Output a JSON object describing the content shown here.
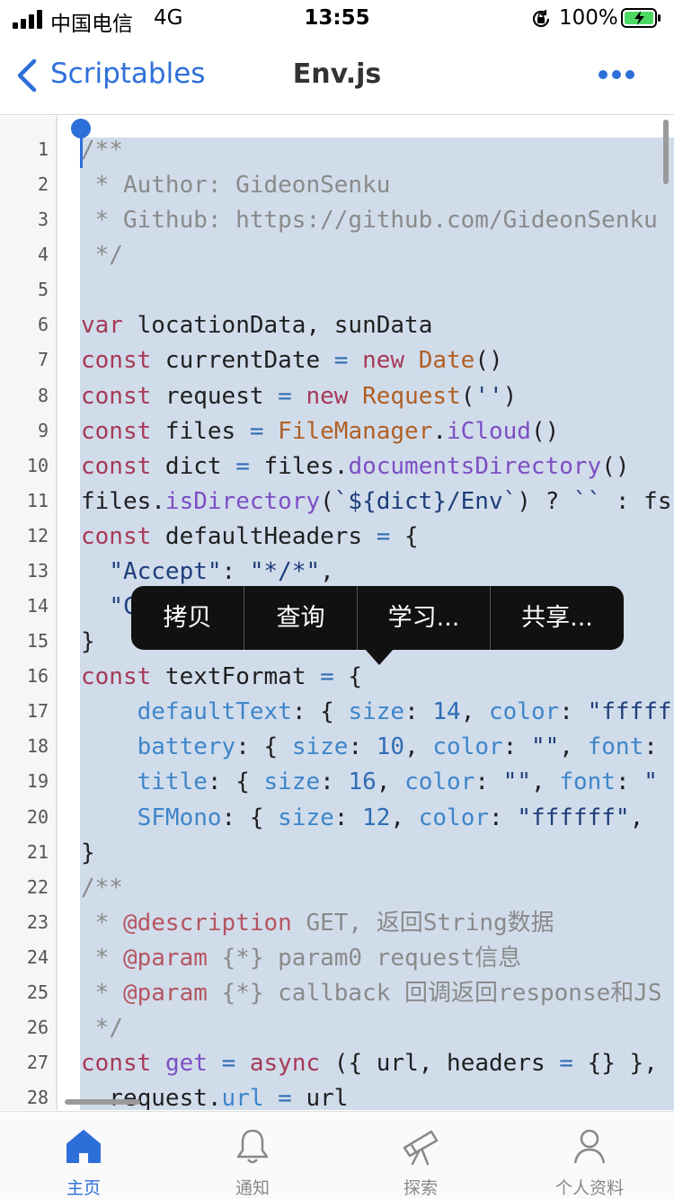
{
  "status_bar": {
    "carrier": "中国电信",
    "network": "4G",
    "time": "13:55",
    "battery_percent": "100%"
  },
  "nav": {
    "back_label": "Scriptables",
    "title": "Env.js",
    "more_icon": "ellipsis-icon",
    "accent_color": "#2d6fd9"
  },
  "editor": {
    "line_numbers": [
      "1",
      "2",
      "3",
      "4",
      "5",
      "6",
      "7",
      "8",
      "9",
      "10",
      "11",
      "12",
      "13",
      "14",
      "15",
      "16",
      "17",
      "18",
      "19",
      "20",
      "21",
      "22",
      "23",
      "24",
      "25",
      "26",
      "27",
      "28"
    ],
    "lines": [
      [
        [
          "c-com",
          "/**"
        ]
      ],
      [
        [
          "c-com",
          " * Author: GideonSenku"
        ]
      ],
      [
        [
          "c-com",
          " * Github: https://github.com/GideonSenku"
        ]
      ],
      [
        [
          "c-com",
          " */"
        ]
      ],
      [],
      [
        [
          "c-kw",
          "var"
        ],
        [
          "c-plain",
          " locationData, sunData"
        ]
      ],
      [
        [
          "c-kw",
          "const"
        ],
        [
          "c-plain",
          " currentDate "
        ],
        [
          "c-op",
          "="
        ],
        [
          "c-plain",
          " "
        ],
        [
          "c-kw",
          "new"
        ],
        [
          "c-plain",
          " "
        ],
        [
          "c-cls",
          "Date"
        ],
        [
          "c-plain",
          "()"
        ]
      ],
      [
        [
          "c-kw",
          "const"
        ],
        [
          "c-plain",
          " request "
        ],
        [
          "c-op",
          "="
        ],
        [
          "c-plain",
          " "
        ],
        [
          "c-kw",
          "new"
        ],
        [
          "c-plain",
          " "
        ],
        [
          "c-cls",
          "Request"
        ],
        [
          "c-plain",
          "("
        ],
        [
          "c-str",
          "''"
        ],
        [
          "c-plain",
          ")"
        ]
      ],
      [
        [
          "c-kw",
          "const"
        ],
        [
          "c-plain",
          " files "
        ],
        [
          "c-op",
          "="
        ],
        [
          "c-plain",
          " "
        ],
        [
          "c-cls",
          "FileManager"
        ],
        [
          "c-plain",
          "."
        ],
        [
          "c-fn",
          "iCloud"
        ],
        [
          "c-plain",
          "()"
        ]
      ],
      [
        [
          "c-kw",
          "const"
        ],
        [
          "c-plain",
          " dict "
        ],
        [
          "c-op",
          "="
        ],
        [
          "c-plain",
          " files."
        ],
        [
          "c-fn",
          "documentsDirectory"
        ],
        [
          "c-plain",
          "()"
        ]
      ],
      [
        [
          "c-plain",
          "files."
        ],
        [
          "c-fn",
          "isDirectory"
        ],
        [
          "c-plain",
          "("
        ],
        [
          "c-str",
          "`${dict}/Env`"
        ],
        [
          "c-plain",
          ") ? "
        ],
        [
          "c-str",
          "``"
        ],
        [
          "c-plain",
          " : fs"
        ]
      ],
      [
        [
          "c-kw",
          "const"
        ],
        [
          "c-plain",
          " defaultHeaders "
        ],
        [
          "c-op",
          "="
        ],
        [
          "c-plain",
          " {"
        ]
      ],
      [
        [
          "c-plain",
          "  "
        ],
        [
          "c-str",
          "\"Accept\""
        ],
        [
          "c-plain",
          ": "
        ],
        [
          "c-str",
          "\"*/*\""
        ],
        [
          "c-plain",
          ","
        ]
      ],
      [
        [
          "c-plain",
          "  "
        ],
        [
          "c-str",
          "\"C"
        ]
      ],
      [
        [
          "c-plain",
          "}"
        ]
      ],
      [
        [
          "c-kw",
          "const"
        ],
        [
          "c-plain",
          " textFormat "
        ],
        [
          "c-op",
          "="
        ],
        [
          "c-plain",
          " {"
        ]
      ],
      [
        [
          "c-plain",
          "    "
        ],
        [
          "c-prop",
          "defaultText"
        ],
        [
          "c-plain",
          ": { "
        ],
        [
          "c-prop",
          "size"
        ],
        [
          "c-plain",
          ": "
        ],
        [
          "c-num",
          "14"
        ],
        [
          "c-plain",
          ", "
        ],
        [
          "c-prop",
          "color"
        ],
        [
          "c-plain",
          ": "
        ],
        [
          "c-str",
          "\"fffff"
        ]
      ],
      [
        [
          "c-plain",
          "    "
        ],
        [
          "c-prop",
          "battery"
        ],
        [
          "c-plain",
          ": { "
        ],
        [
          "c-prop",
          "size"
        ],
        [
          "c-plain",
          ": "
        ],
        [
          "c-num",
          "10"
        ],
        [
          "c-plain",
          ", "
        ],
        [
          "c-prop",
          "color"
        ],
        [
          "c-plain",
          ": "
        ],
        [
          "c-str",
          "\"\""
        ],
        [
          "c-plain",
          ", "
        ],
        [
          "c-prop",
          "font"
        ],
        [
          "c-plain",
          ":"
        ]
      ],
      [
        [
          "c-plain",
          "    "
        ],
        [
          "c-prop",
          "title"
        ],
        [
          "c-plain",
          ": { "
        ],
        [
          "c-prop",
          "size"
        ],
        [
          "c-plain",
          ": "
        ],
        [
          "c-num",
          "16"
        ],
        [
          "c-plain",
          ", "
        ],
        [
          "c-prop",
          "color"
        ],
        [
          "c-plain",
          ": "
        ],
        [
          "c-str",
          "\"\""
        ],
        [
          "c-plain",
          ", "
        ],
        [
          "c-prop",
          "font"
        ],
        [
          "c-plain",
          ": "
        ],
        [
          "c-str",
          "\""
        ]
      ],
      [
        [
          "c-plain",
          "    "
        ],
        [
          "c-prop",
          "SFMono"
        ],
        [
          "c-plain",
          ": { "
        ],
        [
          "c-prop",
          "size"
        ],
        [
          "c-plain",
          ": "
        ],
        [
          "c-num",
          "12"
        ],
        [
          "c-plain",
          ", "
        ],
        [
          "c-prop",
          "color"
        ],
        [
          "c-plain",
          ": "
        ],
        [
          "c-str",
          "\"ffffff\""
        ],
        [
          "c-plain",
          ", "
        ]
      ],
      [
        [
          "c-plain",
          "}"
        ]
      ],
      [
        [
          "c-com",
          "/**"
        ]
      ],
      [
        [
          "c-com",
          " * "
        ],
        [
          "c-tag",
          "@description"
        ],
        [
          "c-com",
          " GET, 返回String数据"
        ]
      ],
      [
        [
          "c-com",
          " * "
        ],
        [
          "c-tag",
          "@param"
        ],
        [
          "c-com",
          " {*} param0 request信息"
        ]
      ],
      [
        [
          "c-com",
          " * "
        ],
        [
          "c-tag",
          "@param"
        ],
        [
          "c-com",
          " {*} callback 回调返回response和JS"
        ]
      ],
      [
        [
          "c-com",
          " */"
        ]
      ],
      [
        [
          "c-kw",
          "const"
        ],
        [
          "c-plain",
          " "
        ],
        [
          "c-fn",
          "get"
        ],
        [
          "c-plain",
          " "
        ],
        [
          "c-op",
          "="
        ],
        [
          "c-plain",
          " "
        ],
        [
          "c-kw",
          "async"
        ],
        [
          "c-plain",
          " ({ url, headers "
        ],
        [
          "c-op",
          "="
        ],
        [
          "c-plain",
          " {} },"
        ]
      ],
      [
        [
          "c-plain",
          "  request."
        ],
        [
          "c-prop",
          "url"
        ],
        [
          "c-plain",
          " "
        ],
        [
          "c-op",
          "="
        ],
        [
          "c-plain",
          " url"
        ]
      ]
    ]
  },
  "context_menu": {
    "items": [
      "拷贝",
      "查询",
      "学习...",
      "共享..."
    ]
  },
  "tab_bar": {
    "tabs": [
      {
        "label": "主页",
        "icon": "home-icon",
        "active": true
      },
      {
        "label": "通知",
        "icon": "bell-icon",
        "active": false
      },
      {
        "label": "探索",
        "icon": "telescope-icon",
        "active": false
      },
      {
        "label": "个人资料",
        "icon": "person-icon",
        "active": false
      }
    ]
  }
}
